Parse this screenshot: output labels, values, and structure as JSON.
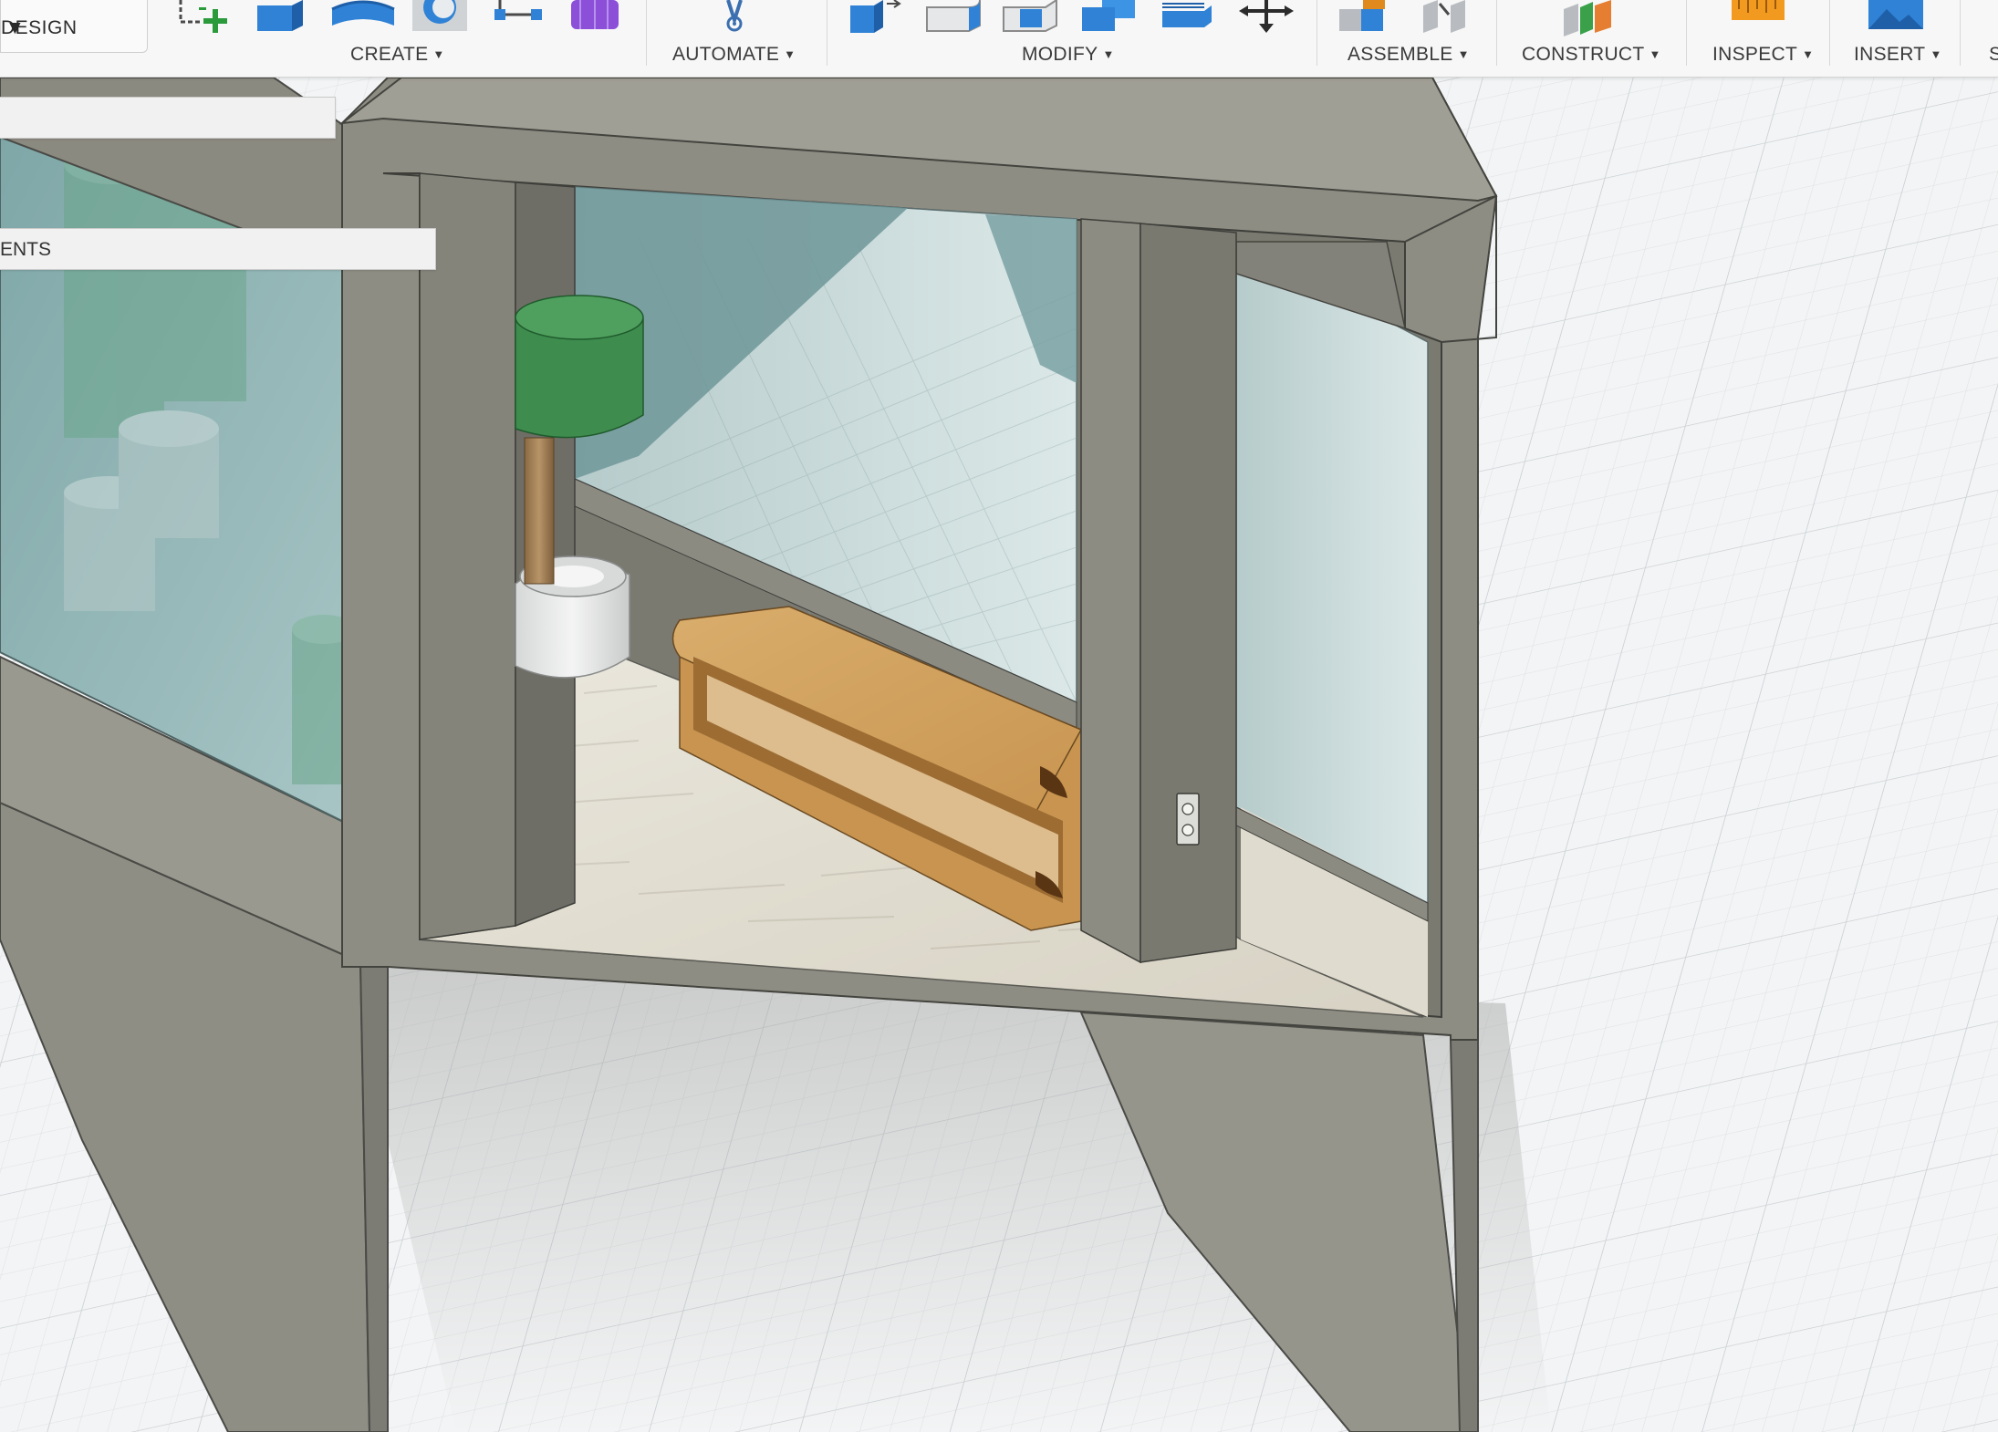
{
  "toolbar": {
    "workspace_label": "DESIGN",
    "groups": [
      {
        "label": "CREATE"
      },
      {
        "label": "AUTOMATE"
      },
      {
        "label": "MODIFY"
      },
      {
        "label": "ASSEMBLE"
      },
      {
        "label": "CONSTRUCT"
      },
      {
        "label": "INSPECT"
      },
      {
        "label": "INSERT"
      },
      {
        "label": "S"
      }
    ],
    "icons": [
      "sketch-icon",
      "extrude-icon",
      "revolve-icon",
      "hole-icon",
      "pattern-icon",
      "form-icon",
      "automate-icon",
      "press-pull-icon",
      "fillet-icon",
      "chamfer-icon",
      "shell-icon",
      "combine-icon",
      "move-icon",
      "new-component-icon",
      "joint-icon",
      "plane-icon",
      "measure-icon",
      "insert-image-icon"
    ]
  },
  "browser": {
    "doc_row_label": "",
    "components_label": "ENTS"
  },
  "viewport": {
    "scene": "section view of cabin interior with bench, potted plant and wall outlet",
    "colors": {
      "wall": "#8d8c82",
      "wall_light": "#9f9d92",
      "glass": "#8fb4b4",
      "floor": "#e3dfd3",
      "bench": "#d2a462",
      "plant": "#3e8c4e",
      "grid_bg": "#f2f3f4",
      "grid_line": "#d8dde0"
    }
  }
}
